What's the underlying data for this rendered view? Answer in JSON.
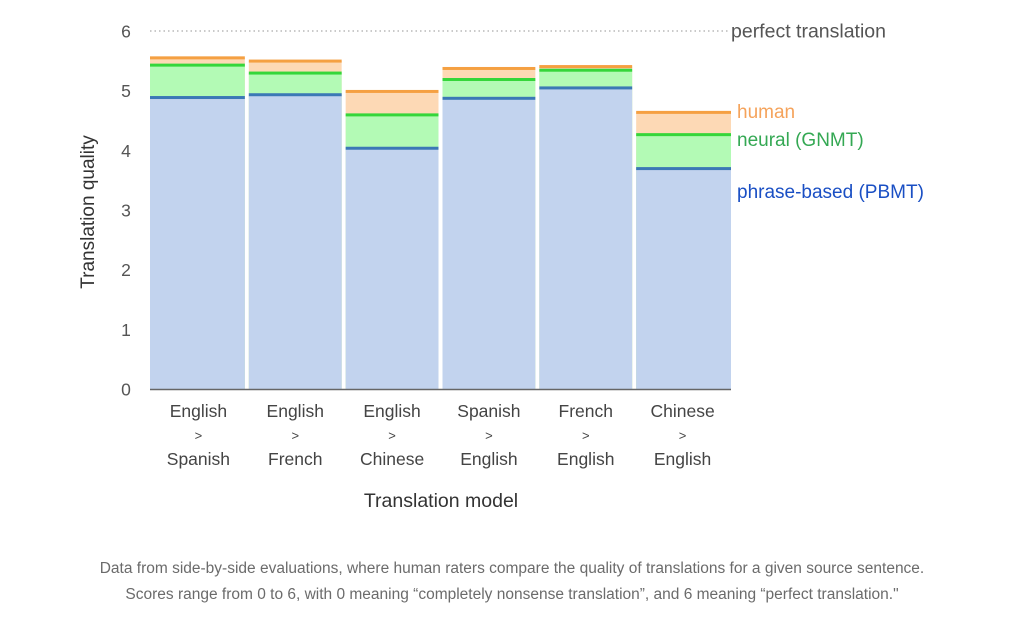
{
  "chart_data": {
    "type": "bar",
    "stacked_overlay": true,
    "title": "",
    "xlabel": "Translation model",
    "ylabel": "Translation quality",
    "ylim": [
      0,
      6
    ],
    "yticks": [
      0,
      1,
      2,
      3,
      4,
      5,
      6
    ],
    "grid": false,
    "categories": [
      [
        "English",
        ">",
        "Spanish"
      ],
      [
        "English",
        ">",
        "French"
      ],
      [
        "English",
        ">",
        "Chinese"
      ],
      [
        "Spanish",
        ">",
        "English"
      ],
      [
        "French",
        ">",
        "English"
      ],
      [
        "Chinese",
        ">",
        "English"
      ]
    ],
    "series": [
      {
        "name": "phrase-based (PBMT)",
        "key": "pbmt",
        "color": "#1a4fc4",
        "line_color": "#3b78b5",
        "fill_color": "#c2d3ee",
        "values": [
          4.885,
          4.932,
          4.035,
          4.872,
          5.046,
          3.694
        ]
      },
      {
        "name": "neural (GNMT)",
        "key": "gnmt",
        "color": "#34a853",
        "line_color": "#35d63a",
        "fill_color": "#b3fab5",
        "values": [
          5.428,
          5.295,
          4.594,
          5.187,
          5.343,
          4.263
        ]
      },
      {
        "name": "human",
        "key": "human",
        "color": "#f5a35b",
        "line_color": "#f5a042",
        "fill_color": "#fdd9b5",
        "values": [
          5.55,
          5.496,
          4.987,
          5.372,
          5.404,
          4.636
        ]
      }
    ],
    "reference_line": {
      "value": 6,
      "label": "perfect translation",
      "style": "dotted"
    },
    "legend": {
      "placement": "right"
    }
  },
  "caption": {
    "line1": "Data from side-by-side evaluations, where human raters compare the quality of translations for a given source sentence.",
    "line2": "Scores range from 0 to 6, with 0 meaning “completely nonsense translation”, and 6 meaning “perfect translation.\""
  }
}
